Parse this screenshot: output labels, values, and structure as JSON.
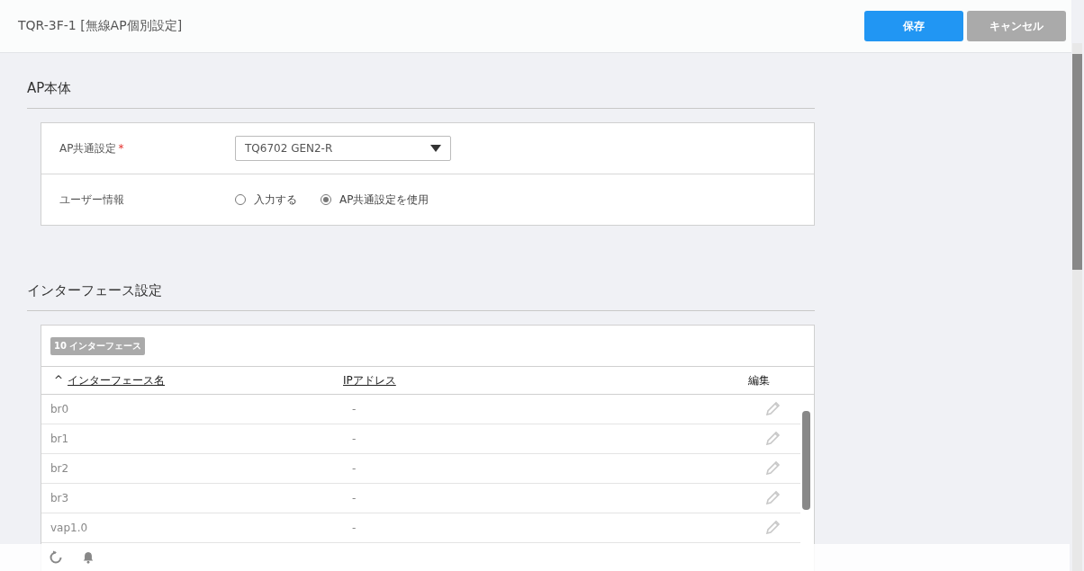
{
  "window": {
    "title": "TQR-3F-1 [無線AP個別設定]"
  },
  "header_buttons": [
    {
      "label": "保存",
      "kind": "primary"
    },
    {
      "label": "キャンセル",
      "kind": "secondary"
    }
  ],
  "ap_body": {
    "title": "AP本体",
    "fields": [
      {
        "kind": "select",
        "label": "AP共通設定",
        "required": true,
        "required_mark": "*",
        "value": "TQ6702 GEN2-R"
      },
      {
        "kind": "radio",
        "label": "ユーザー情報",
        "options": [
          {
            "label": "入力する",
            "selected": false
          },
          {
            "label": "AP共通設定を使用",
            "selected": true
          }
        ]
      }
    ]
  },
  "interfaces": {
    "title": "インターフェース設定",
    "count_badge": "10 インターフェース",
    "columns": [
      {
        "label": "インターフェース名",
        "sort_marker": "^",
        "kind": "sortable"
      },
      {
        "label": "IPアドレス",
        "kind": "sortable"
      },
      {
        "label": "編集",
        "kind": "action"
      }
    ],
    "rows": [
      {
        "name": "br0",
        "ip": "-"
      },
      {
        "name": "br1",
        "ip": "-"
      },
      {
        "name": "br2",
        "ip": "-"
      },
      {
        "name": "br3",
        "ip": "-"
      },
      {
        "name": "vap1.0",
        "ip": "-"
      }
    ]
  }
}
